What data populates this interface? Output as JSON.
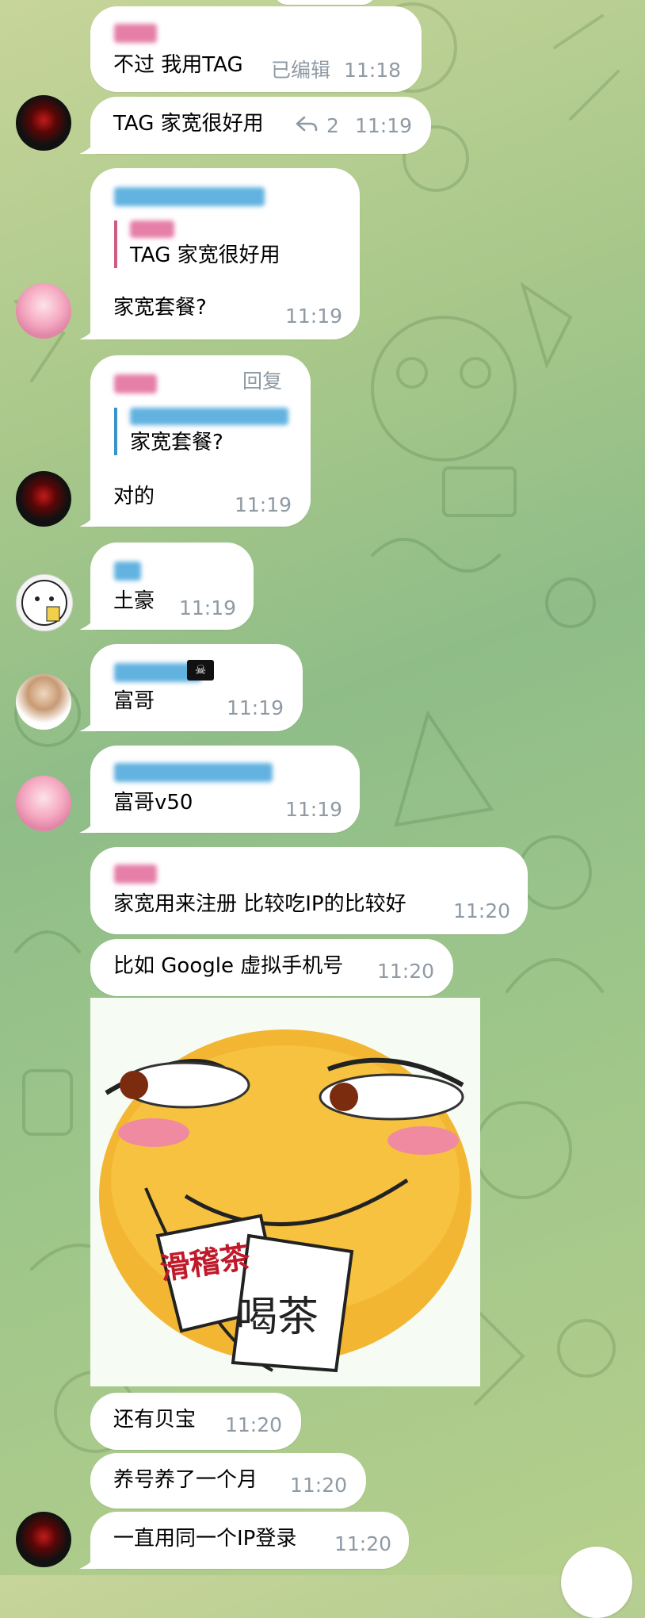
{
  "messages": [
    {
      "text": "不过 我用TAG",
      "edited": "已编辑",
      "time": "11:18"
    },
    {
      "text": "TAG 家宽很好用",
      "replies": "2",
      "time": "11:19"
    },
    {
      "quote_text": "TAG 家宽很好用",
      "text": "家宽套餐?",
      "time": "11:19"
    },
    {
      "reply_label": "回复",
      "quote_text": "家宽套餐?",
      "text": "对的",
      "time": "11:19"
    },
    {
      "text": "土豪",
      "time": "11:19"
    },
    {
      "text": "富哥",
      "time": "11:19"
    },
    {
      "text": "富哥v50",
      "time": "11:19"
    },
    {
      "text": "家宽用来注册 比较吃IP的比较好",
      "time": "11:20"
    },
    {
      "text": "比如 Google 虚拟手机号",
      "time": "11:20"
    },
    {
      "sticker_label": "滑稽茶",
      "sticker_caption": "喝茶"
    },
    {
      "text": "还有贝宝",
      "time": "11:20"
    },
    {
      "text": "养号养了一个月",
      "time": "11:20"
    },
    {
      "text": "一直用同一个IP登录",
      "time": "11:20"
    }
  ],
  "icons": {
    "reply": "reply-arrow-icon",
    "pirate_flag": "pirate-flag-icon"
  },
  "colors": {
    "bubble": "#ffffff",
    "time": "#8f9aa4",
    "quote_pink": "#d05b84",
    "quote_blue": "#3b94c9",
    "sender_pink": "#e57fa8",
    "sender_blue": "#62b2e0"
  }
}
